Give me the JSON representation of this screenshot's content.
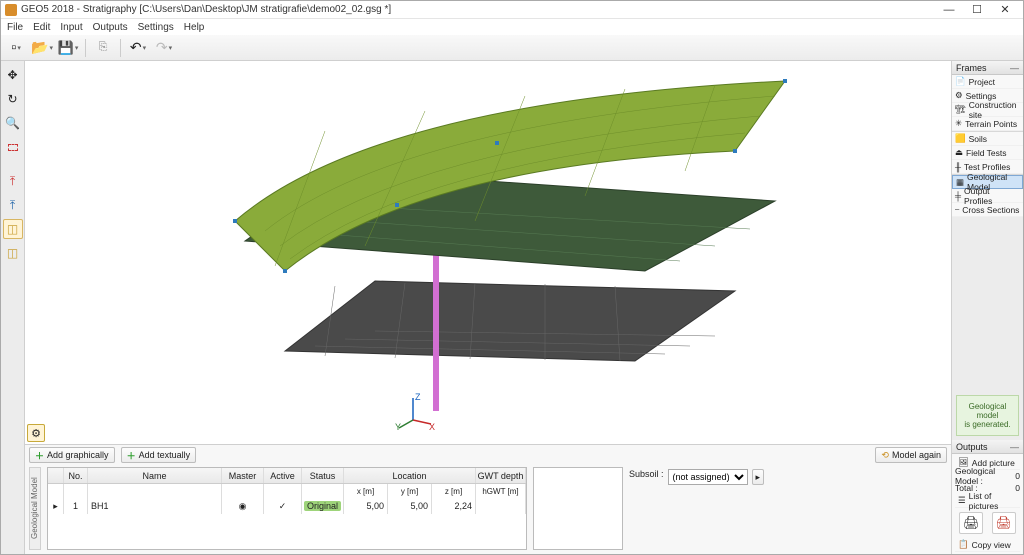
{
  "title": "GEO5 2018 - Stratigraphy [C:\\Users\\Dan\\Desktop\\JM stratigrafie\\demo02_02.gsg *]",
  "menu": {
    "file": "File",
    "edit": "Edit",
    "input": "Input",
    "outputs": "Outputs",
    "settings": "Settings",
    "help": "Help"
  },
  "frames": {
    "title": "Frames",
    "items": [
      {
        "label": "Project",
        "icon": "📄"
      },
      {
        "label": "Settings",
        "icon": "⚙"
      },
      {
        "label": "Construction site",
        "icon": "🏗"
      },
      {
        "label": "Terrain Points",
        "icon": "✳"
      },
      {
        "label": "Soils",
        "icon": "🟨"
      },
      {
        "label": "Field Tests",
        "icon": "⏏"
      },
      {
        "label": "Test Profiles",
        "icon": "╫"
      },
      {
        "label": "Geological Model",
        "icon": "▦",
        "selected": true
      },
      {
        "label": "Output Profiles",
        "icon": "╪"
      },
      {
        "label": "Cross Sections",
        "icon": "⎯"
      }
    ]
  },
  "status": {
    "line1": "Geological model",
    "line2": "is generated."
  },
  "outputs": {
    "title": "Outputs",
    "add_picture": "Add picture",
    "row1_label": "Geological Model :",
    "row1_val": "0",
    "row2_label": "Total :",
    "row2_val": "0",
    "list": "List of pictures",
    "copy": "Copy view"
  },
  "bottom": {
    "add_graph": "Add graphically",
    "add_text": "Add textually",
    "model_again": "Model again",
    "side_label": "Geological Model",
    "subsoil_label": "Subsoil :",
    "subsoil_value": "(not assigned)",
    "headers": {
      "no": "No.",
      "name": "Name",
      "master": "Master",
      "active": "Active",
      "status": "Status",
      "location": "Location",
      "gwt": "GWT depth",
      "x": "x [m]",
      "y": "y [m]",
      "z": "z [m]",
      "h": "hGWT [m]"
    },
    "row": {
      "marker": "▸",
      "no": "1",
      "name": "BH1",
      "master": "◉",
      "active": "✓",
      "status": "Original",
      "x": "5,00",
      "y": "5,00",
      "z": "2,24",
      "h": ""
    }
  },
  "axes": {
    "x": "X",
    "y": "Y",
    "z": "Z"
  }
}
